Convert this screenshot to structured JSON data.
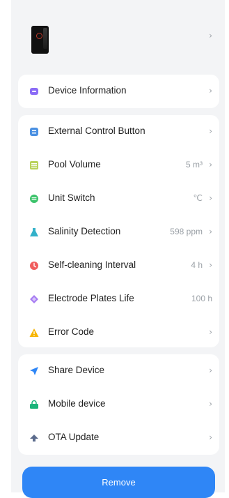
{
  "device": {
    "chevron": "›"
  },
  "info_group": [
    {
      "label": "Device Information",
      "icon": "info-icon",
      "value": "",
      "chevron": "›"
    }
  ],
  "settings_group": [
    {
      "label": "External Control Button",
      "icon": "control-button-icon",
      "value": "",
      "chevron": "›"
    },
    {
      "label": "Pool Volume",
      "icon": "pool-volume-icon",
      "value": "5 m³",
      "chevron": "›"
    },
    {
      "label": "Unit Switch",
      "icon": "unit-switch-icon",
      "value": "℃",
      "chevron": "›"
    },
    {
      "label": "Salinity Detection",
      "icon": "salinity-icon",
      "value": "598 ppm",
      "chevron": "›"
    },
    {
      "label": "Self-cleaning Interval",
      "icon": "clock-icon",
      "value": "4 h",
      "chevron": "›"
    },
    {
      "label": "Electrode Plates Life",
      "icon": "electrode-icon",
      "value": "100 h",
      "chevron": ""
    },
    {
      "label": "Error Code",
      "icon": "warning-icon",
      "value": "",
      "chevron": "›"
    }
  ],
  "share_group": [
    {
      "label": "Share Device",
      "icon": "share-icon",
      "value": "",
      "chevron": "›"
    },
    {
      "label": "Mobile device",
      "icon": "mobile-device-icon",
      "value": "",
      "chevron": "›"
    },
    {
      "label": "OTA Update",
      "icon": "ota-update-icon",
      "value": "",
      "chevron": "›"
    }
  ],
  "remove_label": "Remove",
  "colors": {
    "accent": "#2f86f6",
    "info": "#8b6cf6",
    "control": "#4a90e2",
    "volume": "#b9d25a",
    "unit": "#3cc36b",
    "salinity": "#33b1c9",
    "clock": "#f05d5d",
    "electrode": "#a77cf2",
    "warning": "#f7b500",
    "share": "#2f86f6",
    "mobile": "#19b47a",
    "ota": "#5b6b8c"
  }
}
